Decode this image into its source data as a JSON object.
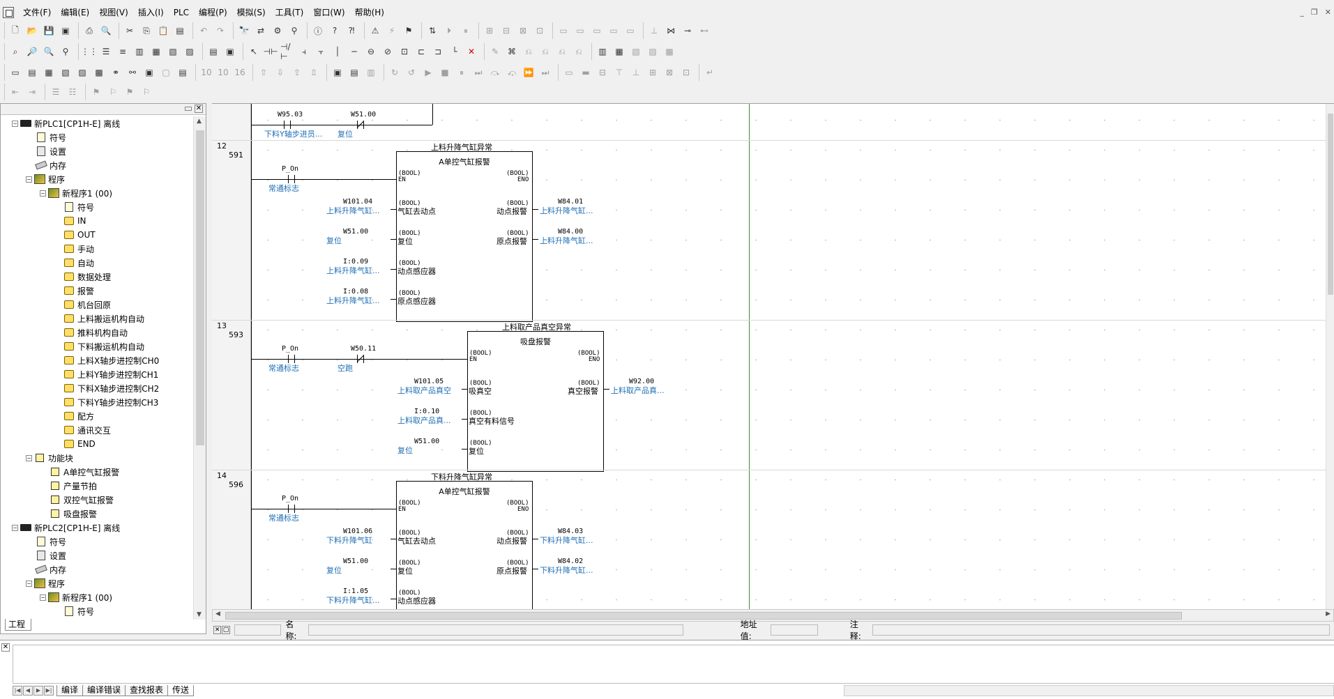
{
  "menu": {
    "items": [
      "文件(F)",
      "编辑(E)",
      "视图(V)",
      "插入(I)",
      "PLC",
      "编程(P)",
      "模拟(S)",
      "工具(T)",
      "窗口(W)",
      "帮助(H)"
    ]
  },
  "project_panel": {
    "tab_label": "工程",
    "tree": [
      {
        "label": "新PLC1[CP1H-E] 离线",
        "icon": "plc-icon",
        "level": 1,
        "toggle": "−"
      },
      {
        "label": "符号",
        "icon": "symbol-icon",
        "level": 2
      },
      {
        "label": "设置",
        "icon": "settings-icon",
        "level": 2
      },
      {
        "label": "内存",
        "icon": "memory-icon",
        "level": 2
      },
      {
        "label": "程序",
        "icon": "programs-icon",
        "level": 2,
        "toggle": "−"
      },
      {
        "label": "新程序1 (00)",
        "icon": "program-icon",
        "level": 3,
        "toggle": "−"
      },
      {
        "label": "符号",
        "icon": "symbol-icon",
        "level": 4
      },
      {
        "label": "IN",
        "icon": "section-icon",
        "level": 4
      },
      {
        "label": "OUT",
        "icon": "section-icon",
        "level": 4
      },
      {
        "label": "手动",
        "icon": "section-icon",
        "level": 4
      },
      {
        "label": "自动",
        "icon": "section-icon",
        "level": 4
      },
      {
        "label": "数据处理",
        "icon": "section-icon",
        "level": 4
      },
      {
        "label": "报警",
        "icon": "section-icon",
        "level": 4
      },
      {
        "label": "机台回原",
        "icon": "section-icon",
        "level": 4
      },
      {
        "label": "上料搬运机构自动",
        "icon": "section-icon",
        "level": 4
      },
      {
        "label": "推料机构自动",
        "icon": "section-icon",
        "level": 4
      },
      {
        "label": "下料搬运机构自动",
        "icon": "section-icon",
        "level": 4
      },
      {
        "label": "上料X轴步进控制CH0",
        "icon": "section-icon",
        "level": 4
      },
      {
        "label": "上料Y轴步进控制CH1",
        "icon": "section-icon",
        "level": 4
      },
      {
        "label": "下料X轴步进控制CH2",
        "icon": "section-icon",
        "level": 4
      },
      {
        "label": "下料Y轴步进控制CH3",
        "icon": "section-icon",
        "level": 4
      },
      {
        "label": "配方",
        "icon": "section-icon",
        "level": 4
      },
      {
        "label": "通讯交互",
        "icon": "section-icon",
        "level": 4
      },
      {
        "label": "END",
        "icon": "section-icon",
        "level": 4
      },
      {
        "label": "功能块",
        "icon": "function-block-icon",
        "level": 2,
        "toggle": "−"
      },
      {
        "label": "A单控气缸报警",
        "icon": "fb-item-icon",
        "level": 3
      },
      {
        "label": "产量节拍",
        "icon": "fb-item-icon",
        "level": 3
      },
      {
        "label": "双控气缸报警",
        "icon": "fb-item-icon",
        "level": 3
      },
      {
        "label": "吸盘报警",
        "icon": "fb-item-icon",
        "level": 3
      },
      {
        "label": "新PLC2[CP1H-E] 离线",
        "icon": "plc-icon",
        "level": 1,
        "toggle": "−"
      },
      {
        "label": "符号",
        "icon": "symbol-icon",
        "level": 2
      },
      {
        "label": "设置",
        "icon": "settings-icon",
        "level": 2
      },
      {
        "label": "内存",
        "icon": "memory-icon",
        "level": 2
      },
      {
        "label": "程序",
        "icon": "programs-icon",
        "level": 2,
        "toggle": "−"
      },
      {
        "label": "新程序1 (00)",
        "icon": "program-icon",
        "level": 3,
        "toggle": "−"
      },
      {
        "label": "符号",
        "icon": "symbol-icon",
        "level": 4
      }
    ]
  },
  "ladder": {
    "top_partial": {
      "contact1_addr": "W95.03",
      "contact1_cmt": "下料Y轴步进员...",
      "contact2_addr": "W51.00",
      "contact2_cmt": "复位"
    },
    "rungs": [
      {
        "num": "12",
        "addr": "591",
        "title": "上料升降气缸异常",
        "fb_name": "A单控气缸报警",
        "en_contact": {
          "addr": "P_On",
          "cmt": "常通标志"
        },
        "inputs": [
          {
            "addr": "W101.04",
            "cmt": "上料升降气缸...",
            "type": "(BOOL)",
            "pin": "气缸去动点"
          },
          {
            "addr": "W51.00",
            "cmt": "复位",
            "type": "(BOOL)",
            "pin": "复位"
          },
          {
            "addr": "I:0.09",
            "cmt": "上料升降气缸...",
            "type": "(BOOL)",
            "pin": "动点感应器"
          },
          {
            "addr": "I:0.08",
            "cmt": "上料升降气缸...",
            "type": "(BOOL)",
            "pin": "原点感应器"
          }
        ],
        "outputs": [
          {
            "addr": "W84.01",
            "cmt": "上料升降气缸...",
            "type": "(BOOL)",
            "pin": "动点报警"
          },
          {
            "addr": "W84.00",
            "cmt": "上料升降气缸...",
            "type": "(BOOL)",
            "pin": "原点报警"
          }
        ]
      },
      {
        "num": "13",
        "addr": "593",
        "title": "上料取产品真空异常",
        "fb_name": "吸盘报警",
        "en_contact": {
          "addr": "P_On",
          "cmt": "常通标志"
        },
        "en_contact2": {
          "addr": "W50.11",
          "cmt": "空跑"
        },
        "inputs": [
          {
            "addr": "W101.05",
            "cmt": "上料取产品真空",
            "type": "(BOOL)",
            "pin": "吸真空"
          },
          {
            "addr": "I:0.10",
            "cmt": "上料取产品真...",
            "type": "(BOOL)",
            "pin": "真空有料信号"
          },
          {
            "addr": "W51.00",
            "cmt": "复位",
            "type": "(BOOL)",
            "pin": "复位"
          }
        ],
        "outputs": [
          {
            "addr": "W92.00",
            "cmt": "上料取产品真...",
            "type": "(BOOL)",
            "pin": "真空报警"
          }
        ]
      },
      {
        "num": "14",
        "addr": "596",
        "title": "下料升降气缸异常",
        "fb_name": "A单控气缸报警",
        "en_contact": {
          "addr": "P_On",
          "cmt": "常通标志"
        },
        "inputs": [
          {
            "addr": "W101.06",
            "cmt": "下料升降气缸",
            "type": "(BOOL)",
            "pin": "气缸去动点"
          },
          {
            "addr": "W51.00",
            "cmt": "复位",
            "type": "(BOOL)",
            "pin": "复位"
          },
          {
            "addr": "I:1.05",
            "cmt": "下料升降气缸...",
            "type": "(BOOL)",
            "pin": "动点感应器"
          }
        ],
        "outputs": [
          {
            "addr": "W84.03",
            "cmt": "下料升降气缸...",
            "type": "(BOOL)",
            "pin": "动点报警"
          },
          {
            "addr": "W84.02",
            "cmt": "下料升降气缸...",
            "type": "(BOOL)",
            "pin": "原点报警"
          }
        ]
      }
    ],
    "en_type": "(BOOL)",
    "en_pin": "EN",
    "eno_type": "(BOOL)",
    "eno_pin": "ENO"
  },
  "infobar": {
    "name_label": "名称:",
    "address_label": "地址值:",
    "comment_label": "注释:"
  },
  "output_window": {
    "tabs": [
      "编译",
      "编译错误",
      "查找报表",
      "传送"
    ],
    "active_tab": "传送"
  },
  "colors": {
    "comment_blue": "#1f6fb5",
    "right_rail": "#3a8a3a"
  }
}
